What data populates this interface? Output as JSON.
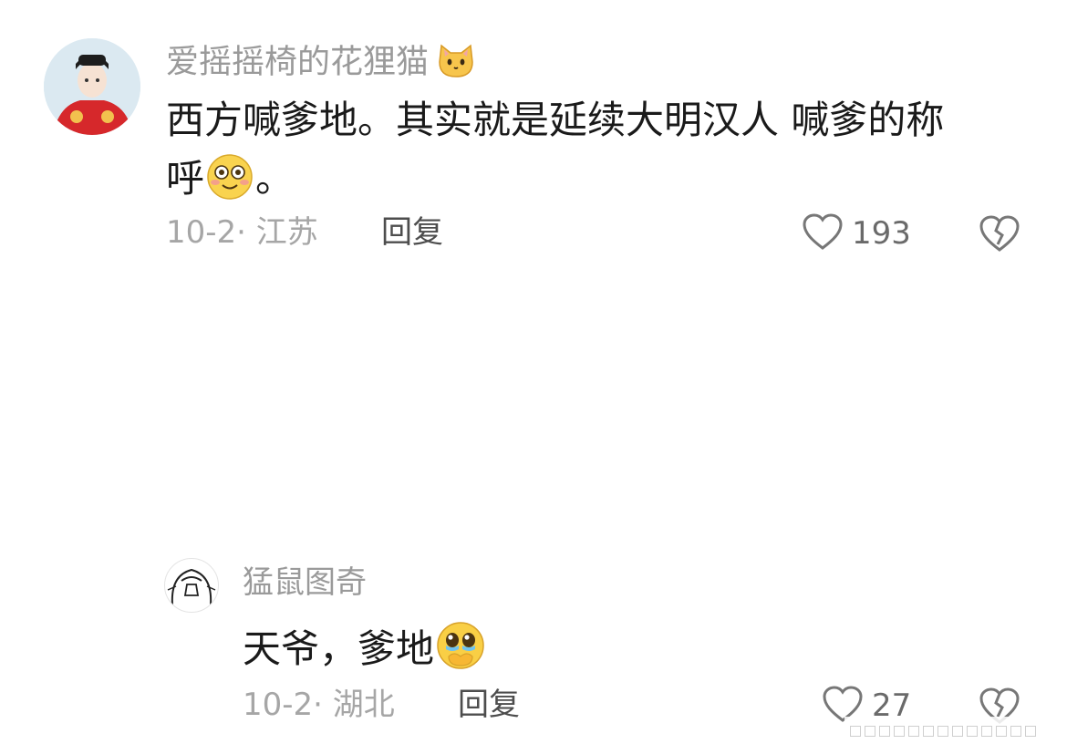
{
  "comments": [
    {
      "user": "爱摇摇椅的花狸猫",
      "user_emoji": "cat-face",
      "text_line1": "西方喊爹地。其实就是延续大明汉人 喊爹的称",
      "text_line2_prefix": "呼",
      "text_emoji": "flushed-smile",
      "text_line2_suffix": "。",
      "meta": "10-2· 江苏",
      "reply_label": "回复",
      "likes": "193"
    },
    {
      "user": "猛鼠图奇",
      "text": "天爷，爹地",
      "text_emoji": "pleading-face-covering-mouth",
      "meta": "10-2· 湖北",
      "reply_label": "回复",
      "likes": "27"
    }
  ],
  "colors": {
    "username": "#9a9a9a",
    "text": "#1a1a1a",
    "meta": "#a6a6a6",
    "icon": "#777777"
  }
}
